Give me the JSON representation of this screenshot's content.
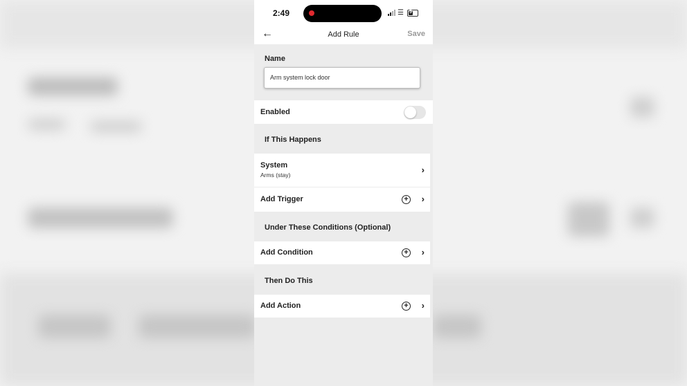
{
  "status_bar": {
    "time": "2:49",
    "battery": "5"
  },
  "nav": {
    "back_icon": "arrow-left-icon",
    "title": "Add Rule",
    "save_label": "Save"
  },
  "name_section": {
    "label": "Name",
    "value": "Arm system lock door"
  },
  "enabled": {
    "label": "Enabled",
    "on": false
  },
  "if_section": {
    "heading": "If This Happens",
    "trigger": {
      "title": "System",
      "detail": "Arms (stay)"
    },
    "add_trigger_label": "Add Trigger"
  },
  "conditions_section": {
    "heading": "Under These Conditions (Optional)",
    "add_condition_label": "Add Condition"
  },
  "then_section": {
    "heading": "Then Do This",
    "add_action_label": "Add Action"
  },
  "colors": {
    "save_disabled": "#9a9a9a",
    "record_dot": "#e0292f"
  }
}
